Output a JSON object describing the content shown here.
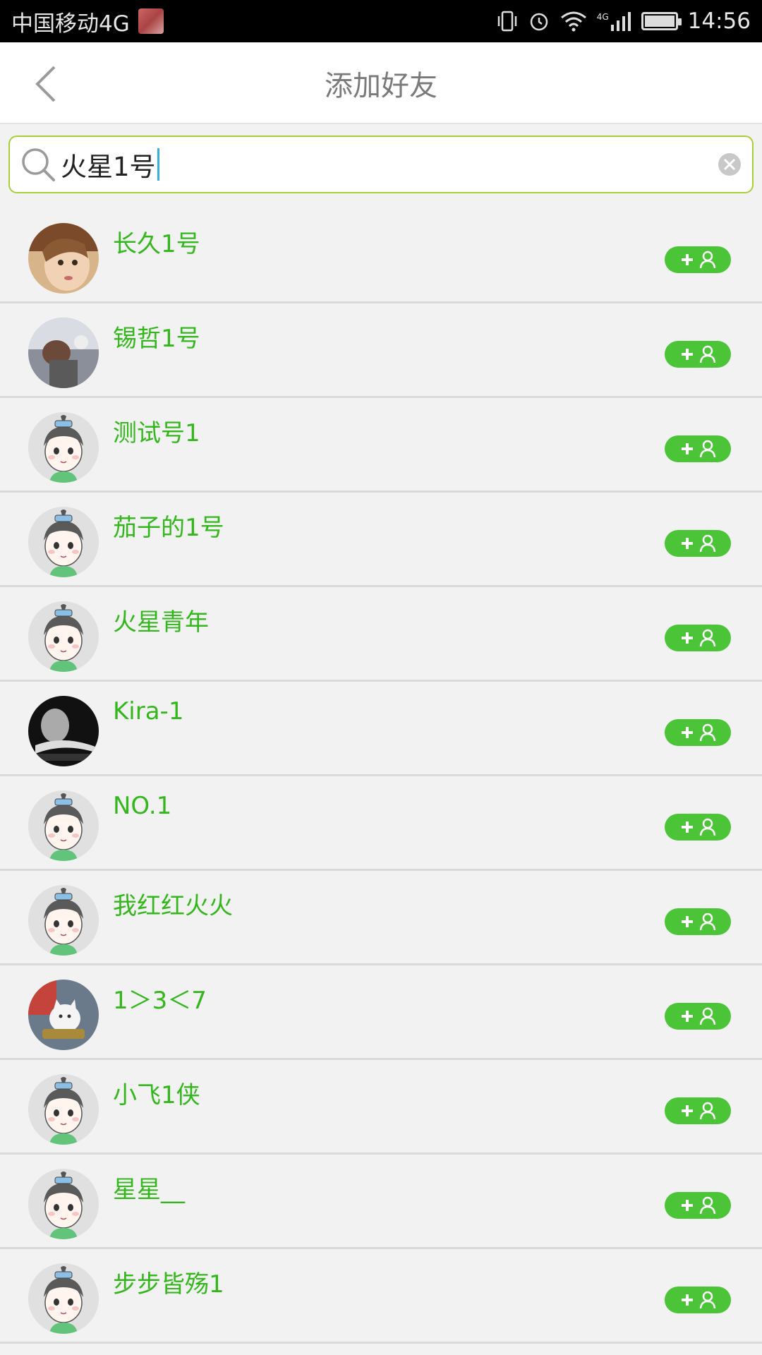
{
  "status_bar": {
    "carrier": "中国移动4G",
    "network": "4G",
    "time": "14:56",
    "icons": [
      "vibrate-icon",
      "alarm-icon",
      "wifi-icon",
      "signal-icon",
      "battery-icon"
    ]
  },
  "header": {
    "title": "添加好友",
    "back_icon": "chevron-left-icon"
  },
  "search": {
    "value": "火星1号",
    "icon": "search-icon",
    "clear_icon": "clear-icon"
  },
  "colors": {
    "accent_green": "#4cc438",
    "name_green": "#34b71d",
    "search_border": "#a6cf3a"
  },
  "results": [
    {
      "name": "长久1号",
      "avatar": "photo-child"
    },
    {
      "name": "锡哲1号",
      "avatar": "photo-person"
    },
    {
      "name": "测试号1",
      "avatar": "default-cartoon"
    },
    {
      "name": "茄子的1号",
      "avatar": "default-cartoon"
    },
    {
      "name": "火星青年",
      "avatar": "default-cartoon"
    },
    {
      "name": "Kira-1",
      "avatar": "photo-bw"
    },
    {
      "name": "NO.1",
      "avatar": "default-cartoon"
    },
    {
      "name": "我红红火火",
      "avatar": "default-cartoon"
    },
    {
      "name": "1＞3＜7",
      "avatar": "photo-cat"
    },
    {
      "name": "小飞1侠",
      "avatar": "default-cartoon"
    },
    {
      "name": "星星__",
      "avatar": "default-cartoon"
    },
    {
      "name": "步步皆殇1",
      "avatar": "default-cartoon"
    }
  ],
  "add_button_icon": "add-user-icon"
}
